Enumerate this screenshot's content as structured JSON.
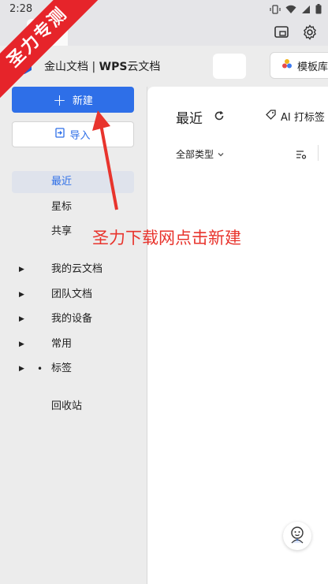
{
  "status_bar": {
    "time": "2:28"
  },
  "watermark": "圣力专测",
  "app_header": {
    "title_prefix": "金山文档 | ",
    "title_bold": "WPS",
    "title_suffix": "云文档",
    "template_label": "模板库"
  },
  "sidebar": {
    "new_label": "新建",
    "import_label": "导入",
    "nav": [
      {
        "label": "最近"
      },
      {
        "label": "星标"
      },
      {
        "label": "共享"
      }
    ],
    "tree": [
      {
        "label": "我的云文档"
      },
      {
        "label": "团队文档"
      },
      {
        "label": "我的设备"
      },
      {
        "label": "常用"
      },
      {
        "label": "标签"
      }
    ],
    "recycle_label": "回收站"
  },
  "main": {
    "title": "最近",
    "ai_tag_label": "AI 打标签",
    "filter_type": "全部类型"
  },
  "annotation": "圣力下载网点击新建",
  "colors": {
    "accent": "#2e6fe8",
    "annotation": "#e8342d"
  }
}
